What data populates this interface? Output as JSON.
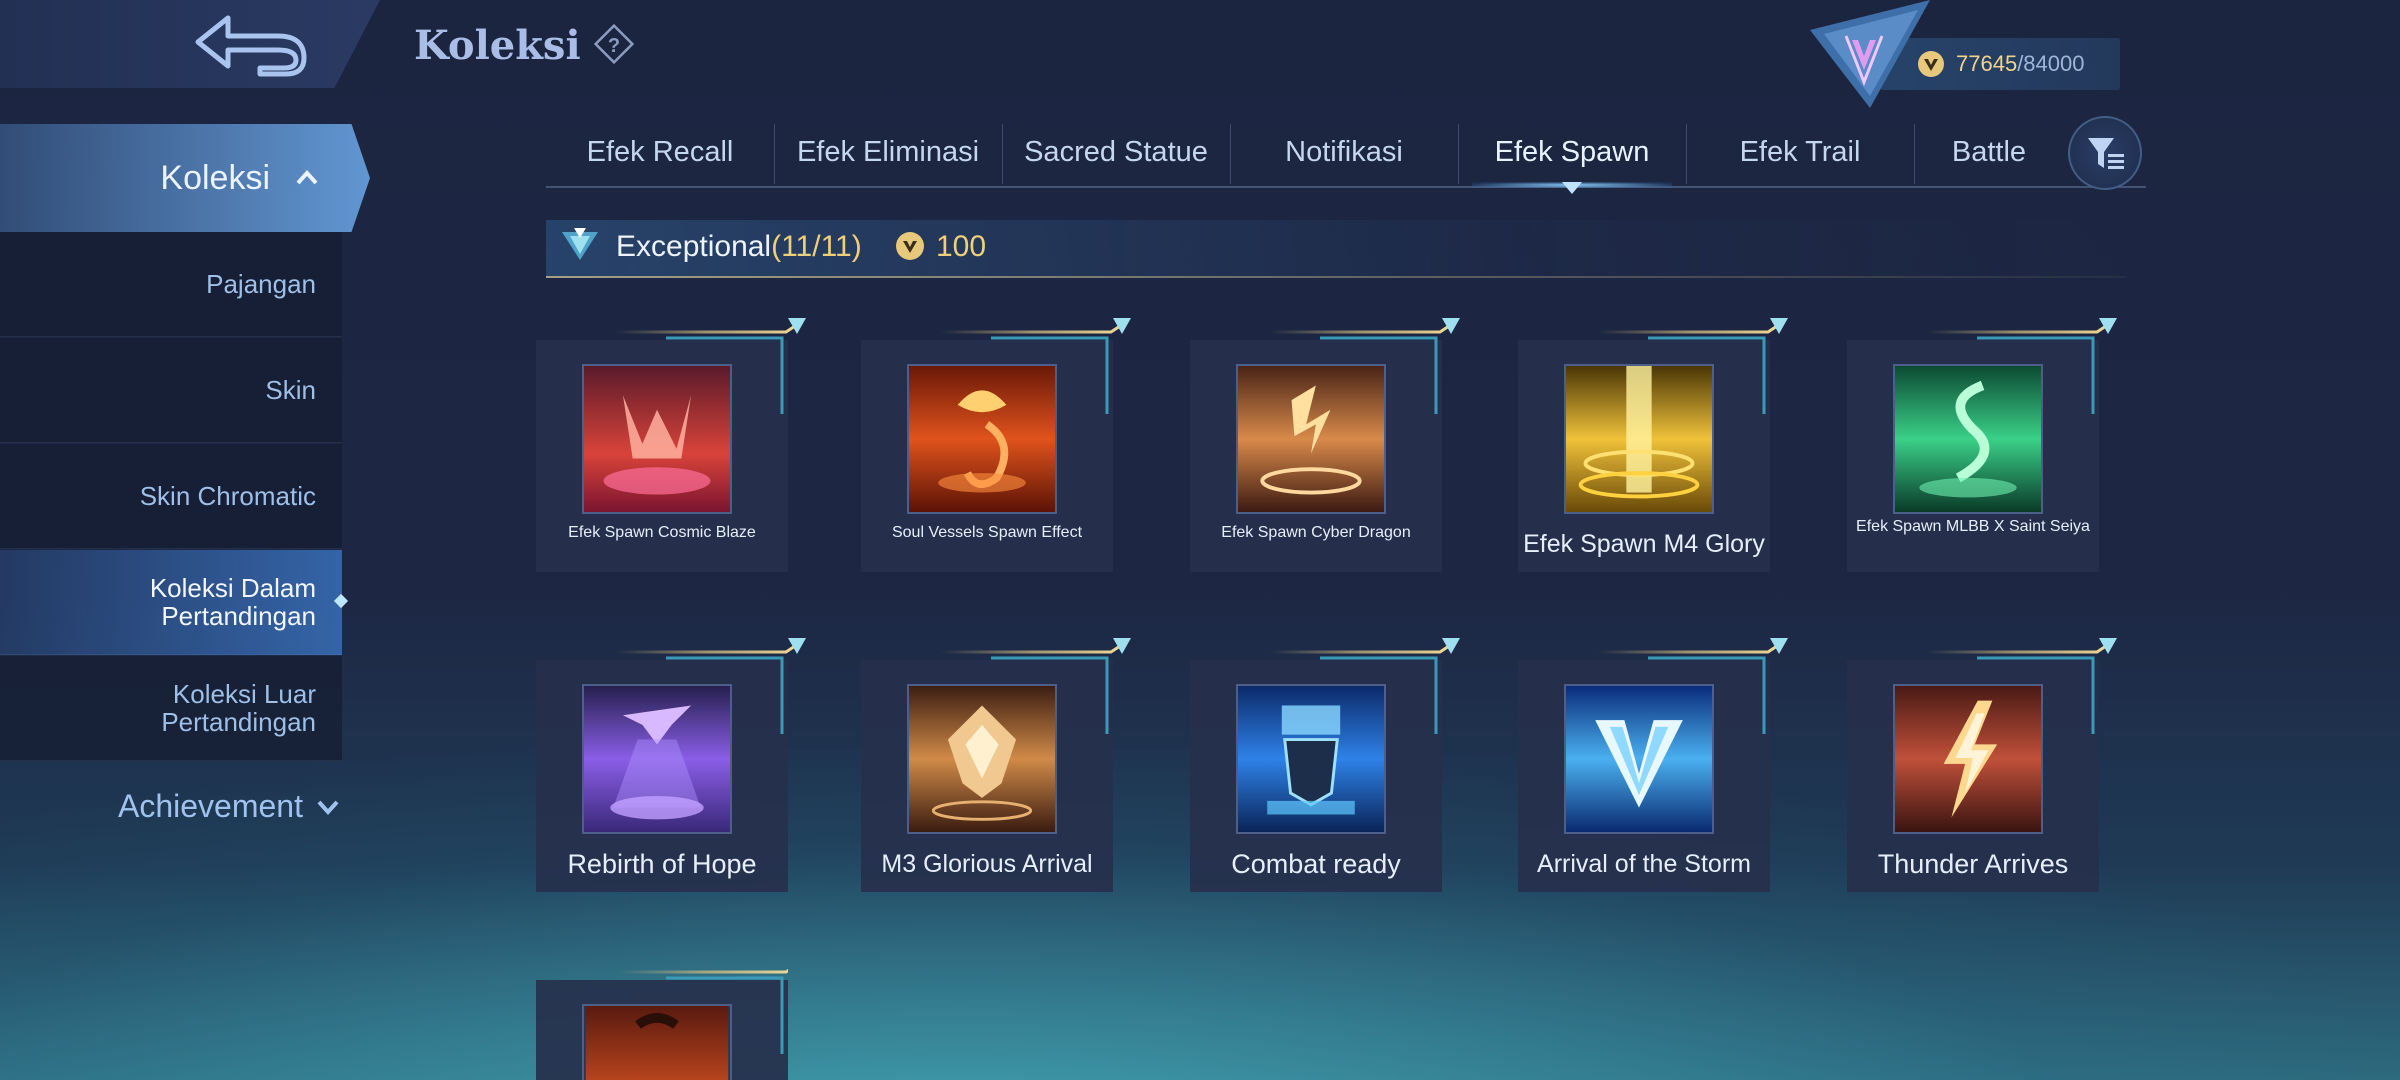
{
  "header": {
    "title": "Koleksi"
  },
  "currency": {
    "current": "77645",
    "max": "/84000"
  },
  "sidebar": {
    "main": "Koleksi",
    "items": [
      {
        "label": "Pajangan"
      },
      {
        "label": "Skin"
      },
      {
        "label": "Skin Chromatic"
      },
      {
        "label": "Koleksi Dalam\nPertandingan",
        "active": true
      },
      {
        "label": "Koleksi Luar\nPertandingan"
      }
    ],
    "achievement": "Achievement"
  },
  "tabs": [
    "Efek Recall",
    "Efek Eliminasi",
    "Sacred Statue",
    "Notifikasi",
    "Efek Spawn",
    "Efek Trail",
    "Battle"
  ],
  "active_tab": "Efek Spawn",
  "section": {
    "title": "Exceptional",
    "count": "(11/11)",
    "cost": "100"
  },
  "cards": [
    {
      "label": "Efek Spawn Cosmic Blaze",
      "size": "small"
    },
    {
      "label": "Soul Vessels Spawn Effect",
      "size": "small"
    },
    {
      "label": "Efek Spawn Cyber Dragon",
      "size": "small"
    },
    {
      "label": "Efek Spawn M4 Glory",
      "size": "mid"
    },
    {
      "label": "Efek Spawn MLBB X Saint Seiya",
      "size": "two"
    },
    {
      "label": "Rebirth of Hope",
      "size": "big"
    },
    {
      "label": "M3 Glorious Arrival",
      "size": "mid"
    },
    {
      "label": "Combat ready",
      "size": "big"
    },
    {
      "label": "Arrival of the Storm",
      "size": "mid"
    },
    {
      "label": "Thunder Arrives",
      "size": "big"
    },
    {
      "label": "",
      "size": "small"
    }
  ],
  "icons": {
    "back": "back-arrow-icon",
    "help": "question-icon",
    "rank": "rank-emblem-icon",
    "coin": "coin-icon",
    "filter": "filter-icon",
    "chevron_up": "chevron-up-icon",
    "chevron_down": "chevron-down-icon"
  },
  "colors": {
    "accent_gold": "#f0cf7c",
    "tab_text": "#c5d6ef",
    "sidebar_active": "#3c78c8"
  }
}
